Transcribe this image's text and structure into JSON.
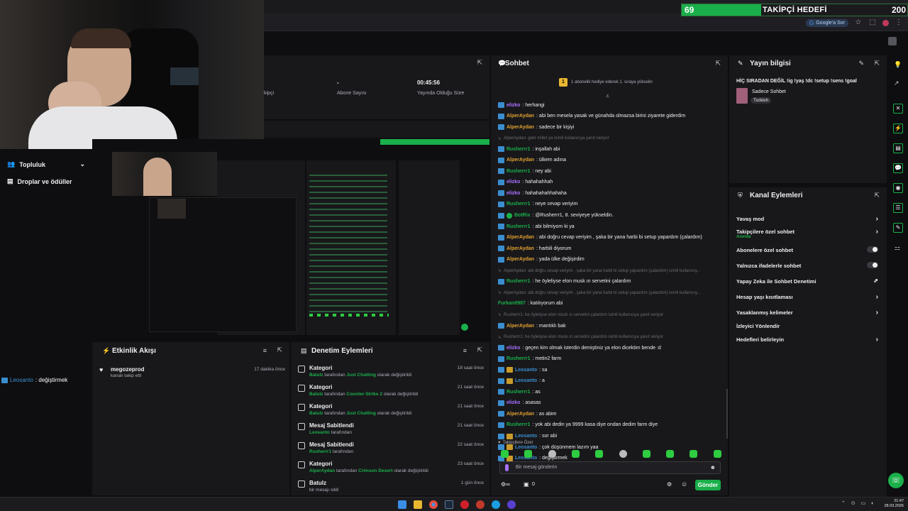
{
  "goal": {
    "current": "69",
    "title": "TAKİPÇİ HEDEFİ",
    "target": "200"
  },
  "browser": {
    "google_sor": "Google'a Sor"
  },
  "sidebar": {
    "items": [
      {
        "label": "Topluluk"
      },
      {
        "label": "Droplar ve ödüller"
      }
    ]
  },
  "left_chat": {
    "user": "Leosanto",
    "text": ": değiştirmek"
  },
  "stats": {
    "followers_label": "kipçi",
    "subs_value": "-",
    "subs_label": "Abone Sayısı",
    "uptime_value": "00:45:56",
    "uptime_label": "Yayında Olduğu Süre"
  },
  "activity_feed": {
    "title": "Etkinlik Akışı",
    "items": [
      {
        "user": "megozeprod",
        "text": "kanalı takip etti",
        "time": "17 dakika önce"
      }
    ]
  },
  "moderation": {
    "title": "Denetim Eylemleri",
    "items": [
      {
        "title": "Kategori",
        "actor": "Batulz",
        "mid": " tarafından ",
        "target": "Just Chatting",
        "suffix": " olarak değiştirildi",
        "time": "18 saat önce"
      },
      {
        "title": "Kategori",
        "actor": "Batulz",
        "mid": " tarafından ",
        "target": "Counter-Strike 2",
        "suffix": " olarak değiştirildi",
        "time": "21 saat önce"
      },
      {
        "title": "Kategori",
        "actor": "Batulz",
        "mid": " tarafından ",
        "target": "Just Chatting",
        "suffix": " olarak değiştirildi",
        "time": "21 saat önce"
      },
      {
        "title": "Mesaj Sabitlendi",
        "actor": "Leosanto",
        "mid": " tarafından",
        "target": "",
        "suffix": "",
        "time": "21 saat önce"
      },
      {
        "title": "Mesaj Sabitlendi",
        "actor": "Rusherrr1",
        "mid": " tarafından",
        "target": "",
        "suffix": "",
        "time": "22 saat önce"
      },
      {
        "title": "Kategori",
        "actor": "AlperAydan",
        "mid": " tarafından ",
        "target": "Crimson Desert",
        "suffix": " olarak değiştirildi",
        "time": "23 saat önce"
      },
      {
        "title": "Batulz",
        "actor": "",
        "mid": "bir mesajı sildi",
        "target": "",
        "suffix": "",
        "time": "1 gün önce"
      }
    ]
  },
  "chat": {
    "title": "Sohbet",
    "pinned": "1 abonelik hediye ederek 1. sıraya yükselin",
    "messages": [
      {
        "user": "elizko",
        "color": "#a970ff",
        "text": ": herhangi",
        "badge": "blue"
      },
      {
        "user": "AlperAydan",
        "color": "#e0a030",
        "text": ": abi ben mesela yasak ve günahda olmazsa birini ziyarete giderdim",
        "badge": "blue"
      },
      {
        "user": "AlperAydan",
        "color": "#e0a030",
        "text": ": sadece bir kişiyi",
        "badge": "blue"
      },
      {
        "reply": "AlperAydan: gelir millet ya isimli kullanıcıya yanıt veriyor"
      },
      {
        "user": "Rusherrr1",
        "color": "#1aaf4a",
        "text": ": inşallah abi",
        "badge": "blue"
      },
      {
        "user": "AlperAydan",
        "color": "#e0a030",
        "text": ": ülkem adına",
        "badge": "blue"
      },
      {
        "user": "Rusherrr1",
        "color": "#1aaf4a",
        "text": ": ney abi",
        "badge": "blue"
      },
      {
        "user": "elizko",
        "color": "#a970ff",
        "text": ": hahahahhah",
        "badge": "blue"
      },
      {
        "user": "elizko",
        "color": "#a970ff",
        "text": ": hahahahahhahaha",
        "badge": "blue"
      },
      {
        "user": "Rusherrr1",
        "color": "#1aaf4a",
        "text": ": neye cevap veriyim",
        "badge": "blue"
      },
      {
        "user": "BotRix",
        "color": "#1aaf4a",
        "text": ": @Rusherrr1, 8. seviyeye yükseldin.",
        "badge": "blue"
      },
      {
        "user": "Rusherrr1",
        "color": "#1aaf4a",
        "text": ": abi bilmiyom ki ya",
        "badge": "blue"
      },
      {
        "user": "AlperAydan",
        "color": "#e0a030",
        "text": ": abi doğru cevap veriyim , şaka bir yana harbi bi setup yapardım (çalardım)",
        "badge": "blue"
      },
      {
        "user": "AlperAydan",
        "color": "#e0a030",
        "text": ": harbili diyorum",
        "badge": "blue"
      },
      {
        "user": "AlperAydan",
        "color": "#e0a030",
        "text": ": yada ülke değişirdim",
        "badge": "blue"
      },
      {
        "reply": "AlperAydan: abi doğru cevap veriyim , şaka bir yana harbi bi setup yapardım (çalardım) isimli kullanıcıy..."
      },
      {
        "user": "Rusherrr1",
        "color": "#1aaf4a",
        "text": ": he öyleliyse elon musk ın servetini çalardım",
        "badge": "blue"
      },
      {
        "reply": "AlperAydan: abi doğru cevap veriyim , şaka bir yana harbi bi setup yapardım (çalardım) isimli kullanıcıy..."
      },
      {
        "user": "Furkan0987",
        "color": "#1aaf4a",
        "text": ": katılıyorum abi",
        "badge": "none"
      },
      {
        "reply": "Rusherrr1: he öyleliyse elon musk ın servetini çalardım isimli kullanıcıya yanıt veriyor"
      },
      {
        "user": "AlperAydan",
        "color": "#e0a030",
        "text": ": mantıklı bak",
        "badge": "blue"
      },
      {
        "reply": "Rusherrr1: he öyleliyse elon musk ın servetini çalardım isimli kullanıcıya yanıt veriyor"
      },
      {
        "user": "elizko",
        "color": "#a970ff",
        "text": ": geçen kim olmak isterdin demiştiniz ya elon dicektim bende :d",
        "badge": "blue"
      },
      {
        "user": "Rusherrr1",
        "color": "#1aaf4a",
        "text": ": metin2 farm",
        "badge": "blue"
      },
      {
        "user": "Leosanto",
        "color": "#3a8ecf",
        "text": ": sa",
        "badge": "gold"
      },
      {
        "user": "Leosanto",
        "color": "#3a8ecf",
        "text": ": a",
        "badge": "gold"
      },
      {
        "user": "Rusherrr1",
        "color": "#1aaf4a",
        "text": ": as",
        "badge": "blue"
      },
      {
        "user": "elizko",
        "color": "#a970ff",
        "text": ": asasas",
        "badge": "blue"
      },
      {
        "user": "AlperAydan",
        "color": "#e0a030",
        "text": ": as abim",
        "badge": "blue"
      },
      {
        "user": "Rusherrr1",
        "color": "#1aaf4a",
        "text": ": yok abi dedin ya 9999 kasa diye ondan dedim farm diye",
        "badge": "blue"
      },
      {
        "user": "Leosanto",
        "color": "#3a8ecf",
        "text": ": sor abi",
        "badge": "gold"
      },
      {
        "user": "Leosanto",
        "color": "#3a8ecf",
        "text": ": çok düşünmem lazım yaa",
        "badge": "gold"
      },
      {
        "user": "Leosanto",
        "color": "#3a8ecf",
        "text": ": değiştirmek",
        "badge": "gold"
      }
    ],
    "followers_only": "Takipçilere Özel",
    "input_placeholder": "Bir mesaj gönderin",
    "points": "0",
    "send": "Gönder"
  },
  "stream_info": {
    "title": "Yayın bilgisi",
    "stream_title": "HİÇ SIRADAN DEĞİL !ig !yaş !dc !setup !sens !goal",
    "category": "Sadece Sohbet",
    "tag": "Turkish"
  },
  "channel_actions": {
    "title": "Kanal Eylemleri",
    "items": [
      {
        "label": "Yavaş mod",
        "control": "chevron"
      },
      {
        "label": "Takipçilere özel sohbet",
        "sub": "Anında",
        "control": "chevron"
      },
      {
        "label": "Abonelere özel sohbet",
        "control": "toggle"
      },
      {
        "label": "Yalnızca ifadelerle sohbet",
        "control": "toggle"
      },
      {
        "label": "Yapay Zeka ile Sohbet Denetimi",
        "control": "external"
      },
      {
        "label": "Hesap yaşı kısıtlaması",
        "control": "chevron"
      },
      {
        "label": "Yasaklanmış kelimeler",
        "control": "chevron"
      },
      {
        "label": "İzleyici Yönlendir",
        "control": "none"
      },
      {
        "label": "Hedefleri belirleyin",
        "control": "chevron"
      }
    ]
  },
  "taskbar": {
    "time": "21:47",
    "date": "28.03.2026"
  },
  "colors": {
    "accent": "#1aaf4a",
    "panel": "#18181b",
    "background": "#0e0e10"
  }
}
